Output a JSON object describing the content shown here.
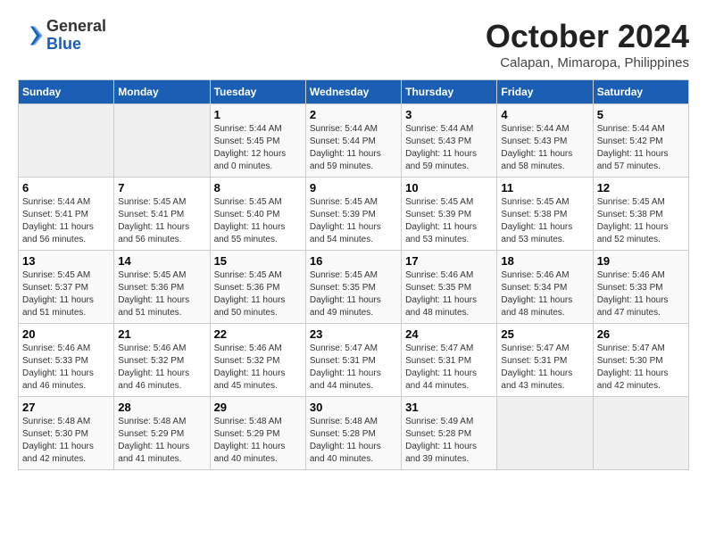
{
  "header": {
    "logo": {
      "line1": "General",
      "line2": "Blue"
    },
    "title": "October 2024",
    "location": "Calapan, Mimaropa, Philippines"
  },
  "days_of_week": [
    "Sunday",
    "Monday",
    "Tuesday",
    "Wednesday",
    "Thursday",
    "Friday",
    "Saturday"
  ],
  "weeks": [
    [
      {
        "day": "",
        "empty": true
      },
      {
        "day": "",
        "empty": true
      },
      {
        "day": "1",
        "sunrise": "Sunrise: 5:44 AM",
        "sunset": "Sunset: 5:45 PM",
        "daylight": "Daylight: 12 hours and 0 minutes."
      },
      {
        "day": "2",
        "sunrise": "Sunrise: 5:44 AM",
        "sunset": "Sunset: 5:44 PM",
        "daylight": "Daylight: 11 hours and 59 minutes."
      },
      {
        "day": "3",
        "sunrise": "Sunrise: 5:44 AM",
        "sunset": "Sunset: 5:43 PM",
        "daylight": "Daylight: 11 hours and 59 minutes."
      },
      {
        "day": "4",
        "sunrise": "Sunrise: 5:44 AM",
        "sunset": "Sunset: 5:43 PM",
        "daylight": "Daylight: 11 hours and 58 minutes."
      },
      {
        "day": "5",
        "sunrise": "Sunrise: 5:44 AM",
        "sunset": "Sunset: 5:42 PM",
        "daylight": "Daylight: 11 hours and 57 minutes."
      }
    ],
    [
      {
        "day": "6",
        "sunrise": "Sunrise: 5:44 AM",
        "sunset": "Sunset: 5:41 PM",
        "daylight": "Daylight: 11 hours and 56 minutes."
      },
      {
        "day": "7",
        "sunrise": "Sunrise: 5:45 AM",
        "sunset": "Sunset: 5:41 PM",
        "daylight": "Daylight: 11 hours and 56 minutes."
      },
      {
        "day": "8",
        "sunrise": "Sunrise: 5:45 AM",
        "sunset": "Sunset: 5:40 PM",
        "daylight": "Daylight: 11 hours and 55 minutes."
      },
      {
        "day": "9",
        "sunrise": "Sunrise: 5:45 AM",
        "sunset": "Sunset: 5:39 PM",
        "daylight": "Daylight: 11 hours and 54 minutes."
      },
      {
        "day": "10",
        "sunrise": "Sunrise: 5:45 AM",
        "sunset": "Sunset: 5:39 PM",
        "daylight": "Daylight: 11 hours and 53 minutes."
      },
      {
        "day": "11",
        "sunrise": "Sunrise: 5:45 AM",
        "sunset": "Sunset: 5:38 PM",
        "daylight": "Daylight: 11 hours and 53 minutes."
      },
      {
        "day": "12",
        "sunrise": "Sunrise: 5:45 AM",
        "sunset": "Sunset: 5:38 PM",
        "daylight": "Daylight: 11 hours and 52 minutes."
      }
    ],
    [
      {
        "day": "13",
        "sunrise": "Sunrise: 5:45 AM",
        "sunset": "Sunset: 5:37 PM",
        "daylight": "Daylight: 11 hours and 51 minutes."
      },
      {
        "day": "14",
        "sunrise": "Sunrise: 5:45 AM",
        "sunset": "Sunset: 5:36 PM",
        "daylight": "Daylight: 11 hours and 51 minutes."
      },
      {
        "day": "15",
        "sunrise": "Sunrise: 5:45 AM",
        "sunset": "Sunset: 5:36 PM",
        "daylight": "Daylight: 11 hours and 50 minutes."
      },
      {
        "day": "16",
        "sunrise": "Sunrise: 5:45 AM",
        "sunset": "Sunset: 5:35 PM",
        "daylight": "Daylight: 11 hours and 49 minutes."
      },
      {
        "day": "17",
        "sunrise": "Sunrise: 5:46 AM",
        "sunset": "Sunset: 5:35 PM",
        "daylight": "Daylight: 11 hours and 48 minutes."
      },
      {
        "day": "18",
        "sunrise": "Sunrise: 5:46 AM",
        "sunset": "Sunset: 5:34 PM",
        "daylight": "Daylight: 11 hours and 48 minutes."
      },
      {
        "day": "19",
        "sunrise": "Sunrise: 5:46 AM",
        "sunset": "Sunset: 5:33 PM",
        "daylight": "Daylight: 11 hours and 47 minutes."
      }
    ],
    [
      {
        "day": "20",
        "sunrise": "Sunrise: 5:46 AM",
        "sunset": "Sunset: 5:33 PM",
        "daylight": "Daylight: 11 hours and 46 minutes."
      },
      {
        "day": "21",
        "sunrise": "Sunrise: 5:46 AM",
        "sunset": "Sunset: 5:32 PM",
        "daylight": "Daylight: 11 hours and 46 minutes."
      },
      {
        "day": "22",
        "sunrise": "Sunrise: 5:46 AM",
        "sunset": "Sunset: 5:32 PM",
        "daylight": "Daylight: 11 hours and 45 minutes."
      },
      {
        "day": "23",
        "sunrise": "Sunrise: 5:47 AM",
        "sunset": "Sunset: 5:31 PM",
        "daylight": "Daylight: 11 hours and 44 minutes."
      },
      {
        "day": "24",
        "sunrise": "Sunrise: 5:47 AM",
        "sunset": "Sunset: 5:31 PM",
        "daylight": "Daylight: 11 hours and 44 minutes."
      },
      {
        "day": "25",
        "sunrise": "Sunrise: 5:47 AM",
        "sunset": "Sunset: 5:31 PM",
        "daylight": "Daylight: 11 hours and 43 minutes."
      },
      {
        "day": "26",
        "sunrise": "Sunrise: 5:47 AM",
        "sunset": "Sunset: 5:30 PM",
        "daylight": "Daylight: 11 hours and 42 minutes."
      }
    ],
    [
      {
        "day": "27",
        "sunrise": "Sunrise: 5:48 AM",
        "sunset": "Sunset: 5:30 PM",
        "daylight": "Daylight: 11 hours and 42 minutes."
      },
      {
        "day": "28",
        "sunrise": "Sunrise: 5:48 AM",
        "sunset": "Sunset: 5:29 PM",
        "daylight": "Daylight: 11 hours and 41 minutes."
      },
      {
        "day": "29",
        "sunrise": "Sunrise: 5:48 AM",
        "sunset": "Sunset: 5:29 PM",
        "daylight": "Daylight: 11 hours and 40 minutes."
      },
      {
        "day": "30",
        "sunrise": "Sunrise: 5:48 AM",
        "sunset": "Sunset: 5:28 PM",
        "daylight": "Daylight: 11 hours and 40 minutes."
      },
      {
        "day": "31",
        "sunrise": "Sunrise: 5:49 AM",
        "sunset": "Sunset: 5:28 PM",
        "daylight": "Daylight: 11 hours and 39 minutes."
      },
      {
        "day": "",
        "empty": true
      },
      {
        "day": "",
        "empty": true
      }
    ]
  ]
}
